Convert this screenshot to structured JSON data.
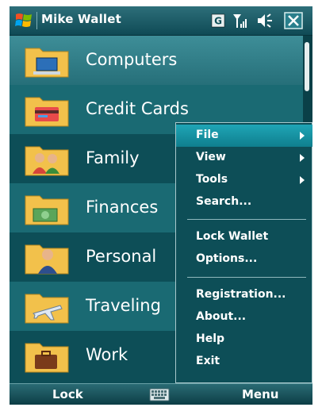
{
  "title_bar": {
    "app_title": "Mike Wallet",
    "status_icons": [
      "g-network-icon",
      "signal-icon",
      "volume-icon",
      "close-icon"
    ],
    "network_letter": "G"
  },
  "folders": [
    {
      "label": "Computers",
      "icon": "computer-folder-icon"
    },
    {
      "label": "Credit Cards",
      "icon": "credit-card-folder-icon"
    },
    {
      "label": "Family",
      "icon": "family-folder-icon"
    },
    {
      "label": "Finances",
      "icon": "money-folder-icon"
    },
    {
      "label": "Personal",
      "icon": "person-folder-icon"
    },
    {
      "label": "Traveling",
      "icon": "airplane-folder-icon"
    },
    {
      "label": "Work",
      "icon": "briefcase-folder-icon"
    }
  ],
  "menu": {
    "items": [
      {
        "label": "File",
        "submenu": true,
        "highlighted": true
      },
      {
        "label": "View",
        "submenu": true
      },
      {
        "label": "Tools",
        "submenu": true
      },
      {
        "label": "Search..."
      },
      {
        "label": "Lock Wallet"
      },
      {
        "label": "Options..."
      },
      {
        "label": "Registration..."
      },
      {
        "label": "About..."
      },
      {
        "label": "Help"
      },
      {
        "label": "Exit"
      }
    ]
  },
  "softkeys": {
    "left": "Lock",
    "right": "Menu",
    "center_icon": "keyboard-icon"
  },
  "colors": {
    "list_dark": "#0d4e57",
    "list_light": "#1a6a73",
    "highlight": "#1fa5b6",
    "folder": "#f2c14b"
  }
}
